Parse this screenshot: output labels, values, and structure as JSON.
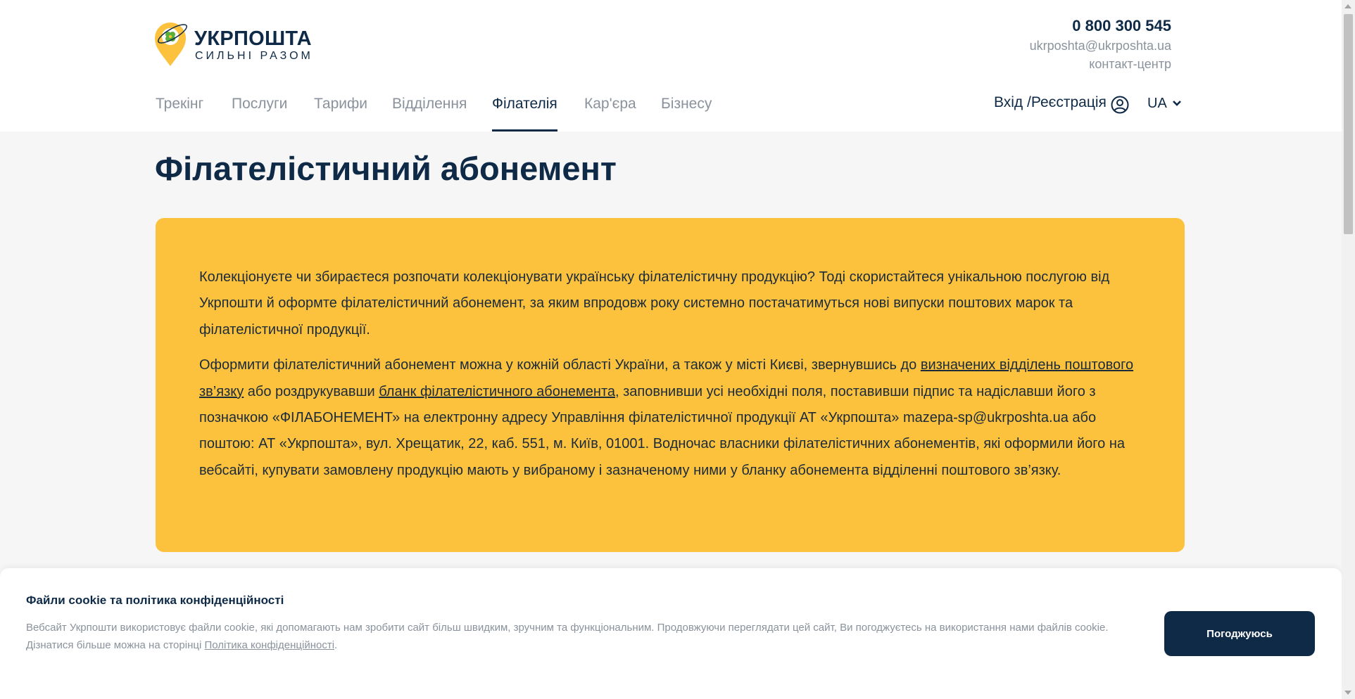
{
  "header": {
    "logo": {
      "name": "УКРПОШТА",
      "slogan": "СИЛЬНІ РАЗОМ"
    },
    "contacts": {
      "phone": "0 800 300 545",
      "email": "ukrposhta@ukrposhta.ua",
      "label": "контакт-центр"
    },
    "nav": [
      {
        "label": "Трекінг",
        "active": false
      },
      {
        "label": "Послуги",
        "active": false
      },
      {
        "label": "Тарифи",
        "active": false
      },
      {
        "label": "Відділення",
        "active": false
      },
      {
        "label": "Філателія",
        "active": true
      },
      {
        "label": "Кар'єра",
        "active": false
      },
      {
        "label": "Бізнесу",
        "active": false
      }
    ],
    "login_label": "Вхід /Реєстрація",
    "login_icon": "user-circle-icon",
    "language": "UA",
    "language_icon": "chevron-down-icon"
  },
  "main": {
    "title": "Філателістичний абонемент",
    "paragraph1": "Колекціонуєте чи збираєтеся розпочати колекціонувати українську філателістичну продукцію? Тоді скористайтеся унікальною послугою від Укрпошти й оформте філателістичний абонемент, за яким впродовж року системно постачатимуться нові випуски поштових марок та філателістичної продукції.",
    "paragraph2": {
      "text_before_link1": "Оформити філателістичний абонемент можна у кожній області України, а також у місті Києві, звернувшись до ",
      "link1": "визначених відділень поштового зв’язку",
      "text_between": " або роздрукувавши ",
      "link2": "бланк філателістичного абонемента",
      "text_after": ", заповнивши усі необхідні поля, поставивши підпис та надіславши його з позначкою «ФІЛАБОНЕМЕНТ» на електронну адресу Управління філателістичної продукції АТ «Укрпошта» mazepa-sp@ukrposhta.ua або поштою: АТ «Укрпошта», вул. Хрещатик, 22, каб. 551, м. Київ, 01001. Водночас власники філателістичних абонементів, які оформили його на вебсайті, купувати замовлену продукцію мають у вибраному і зазначеному ними у бланку абонемента відділенні поштового зв’язку."
    }
  },
  "cookie": {
    "title": "Файли cookie та політика конфіденційності",
    "text": "Вебсайт Укрпошти використовує файли cookie, які допомагають нам зробити сайт більш швидким, зручним та функціональним. Продовжуючи переглядати цей сайт, Ви погоджуєтесь на використання нами файлів cookie.",
    "more_text": "Дізнатися більше можна на сторінці ",
    "link": "Політика конфіденційності",
    "after_link": ".",
    "button": "Погоджуюсь"
  },
  "colors": {
    "brand_navy": "#0e2a47",
    "brand_yellow": "#fcc23e",
    "muted_gray": "#8a929c",
    "page_bg": "#f6f6f6"
  }
}
